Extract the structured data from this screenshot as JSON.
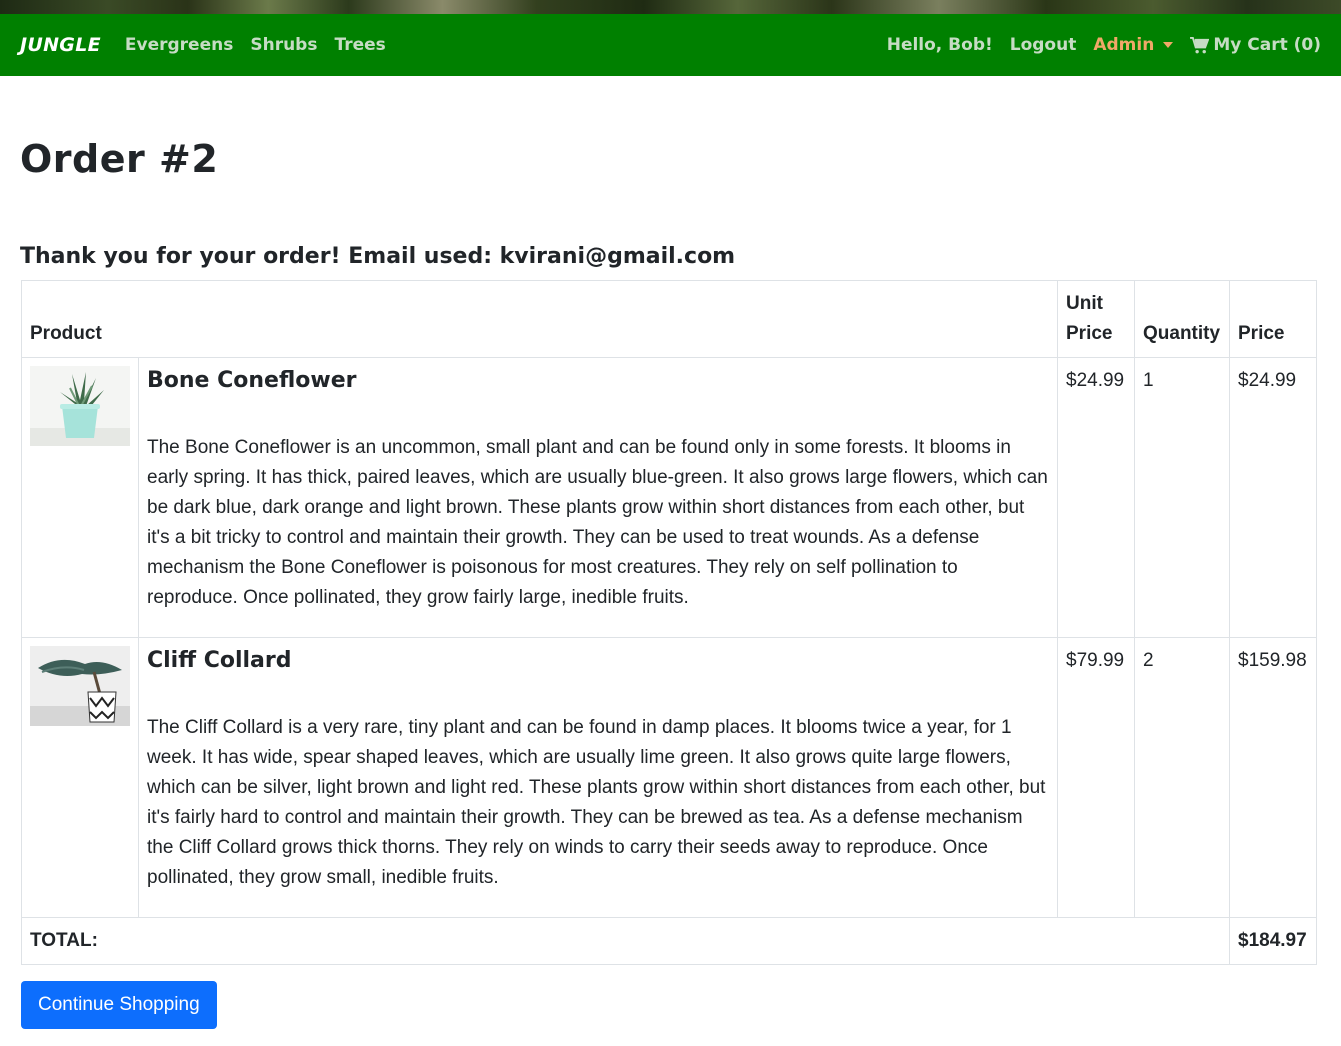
{
  "navbar": {
    "brand": "JUNGLE",
    "links": [
      {
        "label": "Evergreens"
      },
      {
        "label": "Shrubs"
      },
      {
        "label": "Trees"
      }
    ],
    "greeting": "Hello, Bob!",
    "logout": "Logout",
    "admin": "Admin",
    "cart": "My Cart (0)",
    "cart_icon": "shopping-cart-icon",
    "colors": {
      "bar": "#008000",
      "link": "#c6dcc4",
      "admin": "#f0a868"
    }
  },
  "page": {
    "title": "Order #2",
    "thanks": "Thank you for your order! Email used: kvirani@gmail.com"
  },
  "table": {
    "headers": {
      "product": "Product",
      "unit_price": "Unit Price",
      "quantity": "Quantity",
      "price": "Price"
    },
    "items": [
      {
        "name": "Bone Coneflower",
        "description": "The Bone Coneflower is an uncommon, small plant and can be found only in some forests. It blooms in early spring. It has thick, paired leaves, which are usually blue-green. It also grows large flowers, which can be dark blue, dark orange and light brown. These plants grow within short distances from each other, but it's a bit tricky to control and maintain their growth. They can be used to treat wounds. As a defense mechanism the Bone Coneflower is poisonous for most creatures. They rely on self pollination to reproduce. Once pollinated, they grow fairly large, inedible fruits.",
        "unit_price": "$24.99",
        "quantity": "1",
        "price": "$24.99"
      },
      {
        "name": "Cliff Collard",
        "description": "The Cliff Collard is a very rare, tiny plant and can be found in damp places. It blooms twice a year, for 1 week. It has wide, spear shaped leaves, which are usually lime green. It also grows quite large flowers, which can be silver, light brown and light red. These plants grow within short distances from each other, but it's fairly hard to control and maintain their growth. They can be brewed as tea. As a defense mechanism the Cliff Collard grows thick thorns. They rely on winds to carry their seeds away to reproduce. Once pollinated, they grow small, inedible fruits.",
        "unit_price": "$79.99",
        "quantity": "2",
        "price": "$159.98"
      }
    ],
    "total_label": "TOTAL:",
    "total_value": "$184.97"
  },
  "actions": {
    "continue": "Continue Shopping",
    "button_color": "#0d6efd"
  }
}
